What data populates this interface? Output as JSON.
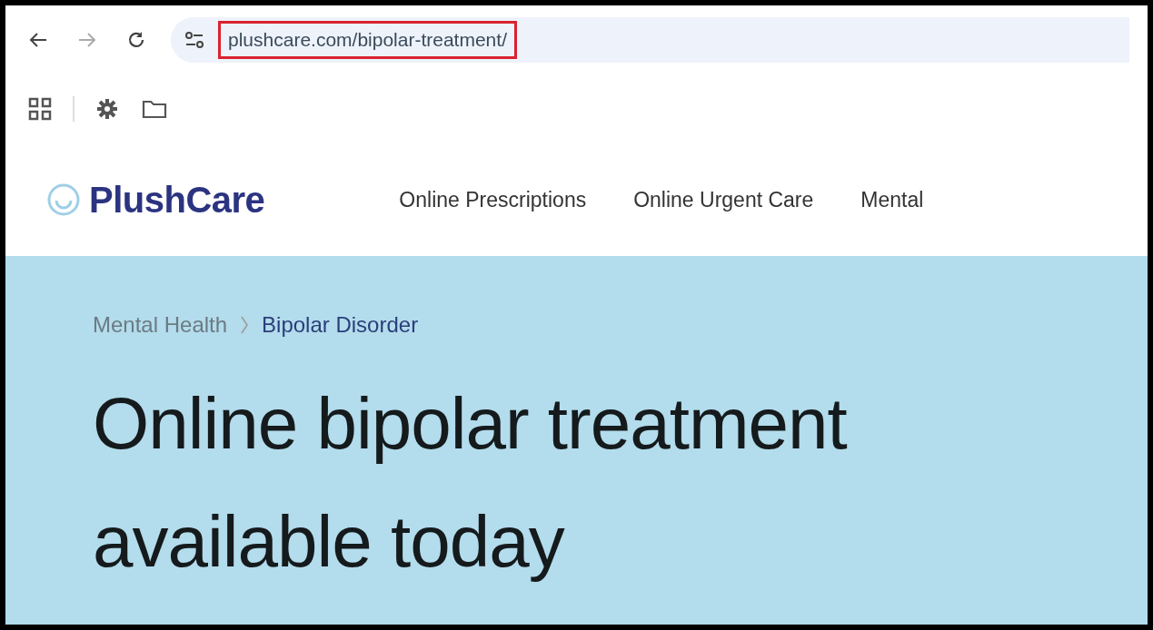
{
  "browser": {
    "url": "plushcare.com/bipolar-treatment/",
    "url_highlighted": true
  },
  "site": {
    "logo": "PlushCare",
    "nav": [
      "Online Prescriptions",
      "Online Urgent Care",
      "Mental"
    ]
  },
  "hero": {
    "breadcrumb": [
      {
        "label": "Mental Health",
        "current": false
      },
      {
        "label": "Bipolar Disorder",
        "current": true
      }
    ],
    "headline_lines": [
      "Online bipolar treatment",
      "available today"
    ]
  }
}
